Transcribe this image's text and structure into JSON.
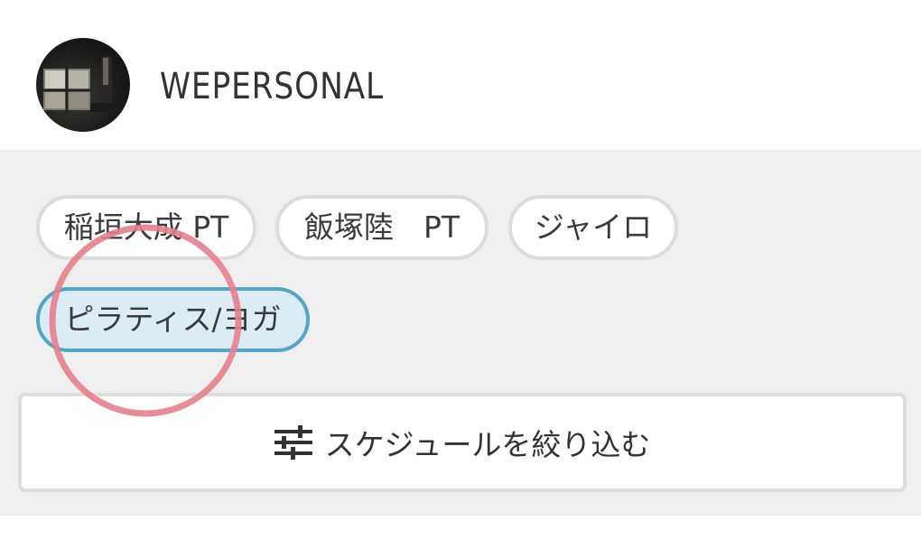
{
  "header": {
    "brand": "WEPERSONAL",
    "avatar_icon": "profile-photo"
  },
  "filters": {
    "chips": [
      {
        "label": "稲垣大成 PT",
        "selected": false
      },
      {
        "label": "飯塚陸　PT",
        "selected": false
      },
      {
        "label": "ジャイロ",
        "selected": false
      },
      {
        "label": "ピラティス/ヨガ",
        "selected": true
      }
    ],
    "filter_button_label": "スケジュールを絞り込む",
    "filter_button_icon": "sliders-icon"
  },
  "colors": {
    "panel_bg": "#efefef",
    "chip_border": "#dcdcdc",
    "selected_bg": "#dcecf5",
    "selected_border": "#54a6c9",
    "annotation": "#e57f8c"
  }
}
